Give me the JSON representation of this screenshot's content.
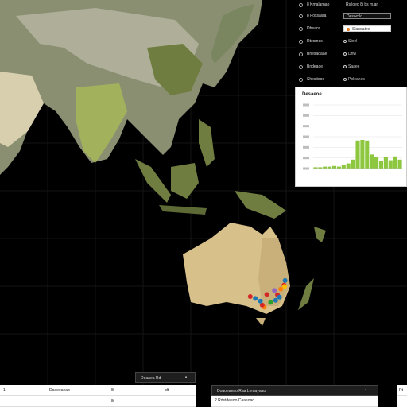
{
  "map": {
    "cluster_points": [
      {
        "lon": 150.2,
        "lat": -33.1,
        "color": "#d62728"
      },
      {
        "lon": 151.0,
        "lat": -34.0,
        "color": "#1f77b4"
      },
      {
        "lon": 149.5,
        "lat": -35.2,
        "color": "#1f77b4"
      },
      {
        "lon": 152.8,
        "lat": -29.5,
        "color": "#d62728"
      },
      {
        "lon": 153.2,
        "lat": -27.8,
        "color": "#1f77b4"
      },
      {
        "lon": 145.0,
        "lat": -37.8,
        "color": "#ff7f0e"
      },
      {
        "lon": 144.2,
        "lat": -37.0,
        "color": "#d62728"
      },
      {
        "lon": 147.5,
        "lat": -36.0,
        "color": "#2ca02c"
      },
      {
        "lon": 143.5,
        "lat": -35.5,
        "color": "#1f77b4"
      },
      {
        "lon": 146.0,
        "lat": -33.0,
        "color": "#d62728"
      },
      {
        "lon": 149.0,
        "lat": -31.5,
        "color": "#9467bd"
      },
      {
        "lon": 151.5,
        "lat": -31.0,
        "color": "#ff7f0e"
      },
      {
        "lon": 141.5,
        "lat": -34.5,
        "color": "#1f77b4"
      },
      {
        "lon": 139.5,
        "lat": -33.8,
        "color": "#d62728"
      },
      {
        "lon": 153.0,
        "lat": -30.0,
        "color": "#ffbf00"
      }
    ],
    "colors": {
      "ocean": "#000000",
      "land_green": "#6f7d40",
      "land_tan": "#c9b07a",
      "land_gray": "#9a9a88",
      "highlight_green": "#b7d04a"
    }
  },
  "layer_panel": {
    "rows": [
      {
        "label": "8 Kmalarnao",
        "value": "Rsiloeo 8i bs m.an"
      },
      {
        "label": "8 Fossalaa",
        "value": "Deswcilo"
      },
      {
        "label": "Dheans",
        "value": "Slandatee"
      },
      {
        "label": "Rtesmos",
        "value": "",
        "option": "Steel"
      },
      {
        "label": "Bnesaoaae",
        "value": "",
        "option": "Dnw"
      },
      {
        "label": "Bndeaoe",
        "option": "Saaee"
      },
      {
        "label": "Bnrensea",
        "option": "",
        "value": ""
      },
      {
        "label": "Shestioos",
        "option": "Poleanes"
      }
    ]
  },
  "chart_data": {
    "type": "bar",
    "title": "Desaeoe",
    "xlabel": "",
    "ylabel": "",
    "ylim": [
      0,
      100
    ],
    "yticks": [
      "",
      "",
      "",
      "",
      "",
      "",
      ""
    ],
    "bar_color": "#8dc63f",
    "values": [
      2,
      2,
      3,
      3,
      4,
      3,
      5,
      8,
      14,
      44,
      45,
      44,
      22,
      18,
      12,
      18,
      13,
      19,
      14
    ]
  },
  "bottom_left": {
    "header": "Doaaea Rd",
    "rows": [
      [
        "1",
        "Doaoeaeao",
        "llt",
        "dt"
      ],
      [
        "",
        "",
        "llt",
        ""
      ]
    ]
  },
  "bottom_center": {
    "header": "Doaoeaeao Raa Lemayaao",
    "row": "2 Rdstdeeoo Caaeoao"
  },
  "bottom_right": {
    "header": "",
    "rows": [
      [
        "Rt"
      ],
      [
        ""
      ]
    ]
  }
}
